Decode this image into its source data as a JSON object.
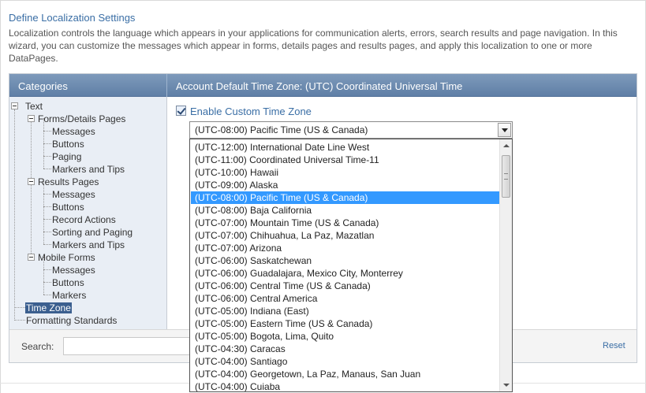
{
  "page": {
    "title": "Define Localization Settings",
    "description": "Localization controls the language which appears in your applications for communication alerts, errors, search results and page navigation. In this wizard, you can customize the messages which appear in forms, details pages and results pages, and apply this localization to one or more DataPages."
  },
  "header": {
    "categories_label": "Categories",
    "timezone_label": "Account Default Time Zone: (UTC) Coordinated Universal Time"
  },
  "tree": {
    "text": "Text",
    "forms_details": "Forms/Details Pages",
    "fd_messages": "Messages",
    "fd_buttons": "Buttons",
    "fd_paging": "Paging",
    "fd_markers": "Markers and Tips",
    "results_pages": "Results Pages",
    "rp_messages": "Messages",
    "rp_buttons": "Buttons",
    "rp_record_actions": "Record Actions",
    "rp_sorting": "Sorting and Paging",
    "rp_markers": "Markers and Tips",
    "mobile_forms": "Mobile Forms",
    "mf_messages": "Messages",
    "mf_buttons": "Buttons",
    "mf_markers": "Markers",
    "time_zone": "Time Zone",
    "formatting": "Formatting Standards"
  },
  "content": {
    "enable_custom_label": "Enable Custom Time Zone",
    "enable_custom_checked": true,
    "selected_timezone": "(UTC-08:00) Pacific Time (US & Canada)"
  },
  "dropdown": {
    "options": [
      "(UTC-12:00) International Date Line West",
      "(UTC-11:00) Coordinated Universal Time-11",
      "(UTC-10:00) Hawaii",
      "(UTC-09:00) Alaska",
      "(UTC-08:00) Pacific Time (US & Canada)",
      "(UTC-08:00) Baja California",
      "(UTC-07:00) Mountain Time (US & Canada)",
      "(UTC-07:00) Chihuahua, La Paz, Mazatlan",
      "(UTC-07:00) Arizona",
      "(UTC-06:00) Saskatchewan",
      "(UTC-06:00) Guadalajara, Mexico City, Monterrey",
      "(UTC-06:00) Central Time (US & Canada)",
      "(UTC-06:00) Central America",
      "(UTC-05:00) Indiana (East)",
      "(UTC-05:00) Eastern Time (US & Canada)",
      "(UTC-05:00) Bogota, Lima, Quito",
      "(UTC-04:30) Caracas",
      "(UTC-04:00) Santiago",
      "(UTC-04:00) Georgetown, La Paz, Manaus, San Juan",
      "(UTC-04:00) Cuiaba"
    ],
    "selected_index": 4
  },
  "footer": {
    "search_label": "Search:",
    "search_value": "",
    "reset_label": "Reset"
  },
  "colors": {
    "header_blue": "#6d8bb1",
    "link_blue": "#3a6ea5",
    "selection_blue": "#3399ff",
    "tree_selected": "#3b5f8f",
    "sidebar_bg": "#e9eef5"
  }
}
